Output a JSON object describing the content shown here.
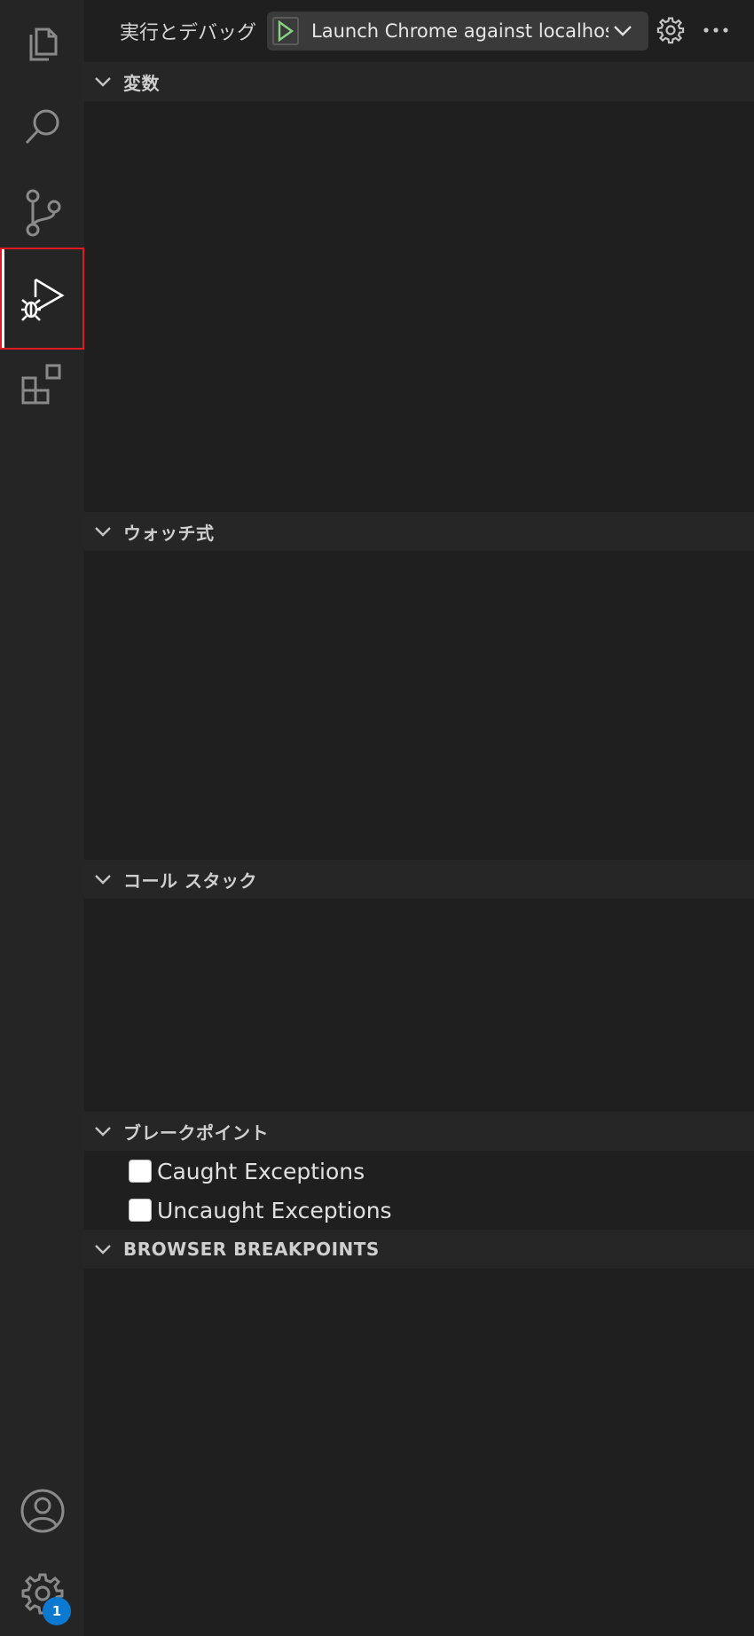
{
  "toolbar": {
    "title": "実行とデバッグ",
    "launch_config": "Launch Chrome against localhost",
    "settings_icon": "gear-icon",
    "more_icon": "ellipsis-icon"
  },
  "activity_bar": {
    "items": [
      {
        "name": "explorer",
        "icon": "files-icon"
      },
      {
        "name": "search",
        "icon": "search-icon"
      },
      {
        "name": "source-control",
        "icon": "source-control-icon"
      },
      {
        "name": "run-and-debug",
        "icon": "debug-icon",
        "active": true
      },
      {
        "name": "extensions",
        "icon": "extensions-icon"
      }
    ],
    "bottom": [
      {
        "name": "accounts",
        "icon": "account-icon"
      },
      {
        "name": "manage",
        "icon": "gear-icon",
        "badge": "1"
      }
    ]
  },
  "sections": {
    "variables": "変数",
    "watch": "ウォッチ式",
    "call_stack": "コール スタック",
    "breakpoints": "ブレークポイント",
    "browser_breakpoints": "BROWSER BREAKPOINTS"
  },
  "breakpoints": {
    "items": [
      {
        "label": "Caught Exceptions",
        "checked": false
      },
      {
        "label": "Uncaught Exceptions",
        "checked": false
      }
    ]
  },
  "colors": {
    "accent_play": "#89d185",
    "active_outline": "#e01b24",
    "badge": "#0b79d0"
  }
}
